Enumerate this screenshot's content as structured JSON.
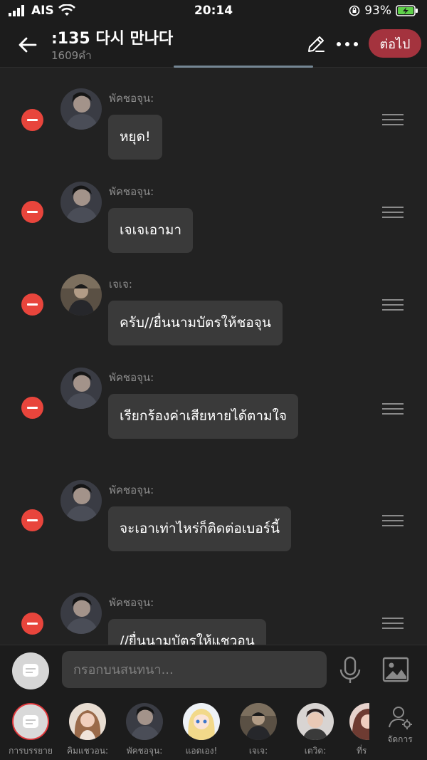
{
  "status_bar": {
    "carrier": "AIS",
    "time": "20:14",
    "battery": "93%"
  },
  "header": {
    "title": ":135 다시 만나다",
    "subtitle": "1609คำ",
    "next_label": "ต่อไป"
  },
  "messages": [
    {
      "speaker": "พัคชอจุน:",
      "text": "หยุด!"
    },
    {
      "speaker": "พัคชอจุน:",
      "text": "เจเจเอามา"
    },
    {
      "speaker": "เจเจ:",
      "text": "ครับ//ยื่นนามบัตรให้ชอจุน"
    },
    {
      "speaker": "พัคชอจุน:",
      "text": "เรียกร้องค่าเสียหายได้ตามใจ"
    },
    {
      "speaker": "พัคชอจุน:",
      "text": "จะเอาเท่าไหร่ก็ติดต่อเบอร์นี้"
    },
    {
      "speaker": "พัคชอจุน:",
      "text": "//ยื่นนามบัตรให้แชวอน"
    }
  ],
  "input": {
    "placeholder": "กรอกบนสนทนา..."
  },
  "characters": [
    {
      "label": "การบรรยาย"
    },
    {
      "label": "คิมแชวอน:"
    },
    {
      "label": "พัคชอจุน:"
    },
    {
      "label": "แอดเอง!"
    },
    {
      "label": "เจเจ:"
    },
    {
      "label": "เตวิด:"
    },
    {
      "label": "ที่ร"
    }
  ],
  "manage_label": "จัดการ",
  "colors": {
    "accent": "#a4333e",
    "delete": "#e8453c",
    "bubble": "#3a3a3a"
  }
}
